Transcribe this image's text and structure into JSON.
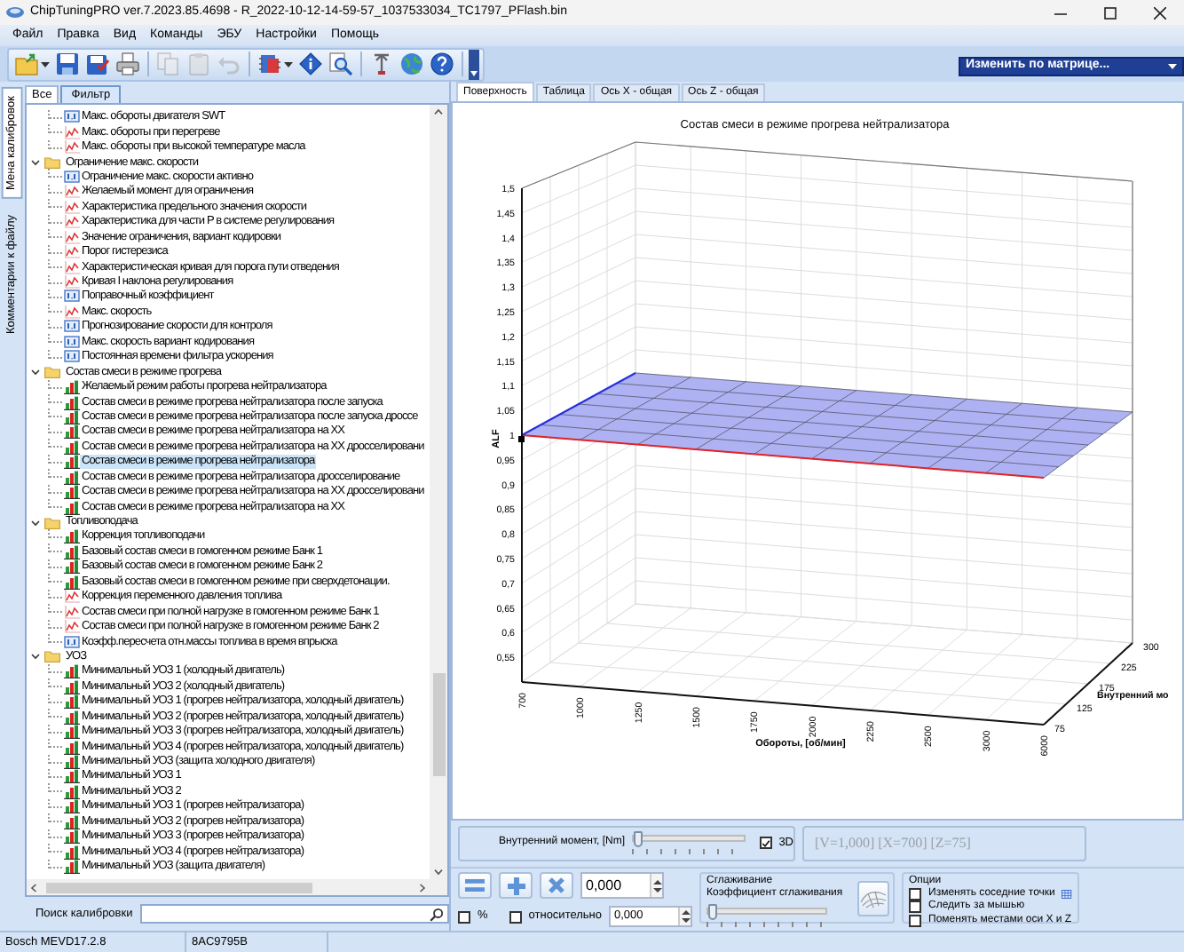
{
  "window": {
    "title": "ChipTuningPRO ver.7.2023.85.4698 - R_2022-10-12-14-59-57_1037533034_TC1797_PFlash.bin"
  },
  "menu": [
    "Файл",
    "Правка",
    "Вид",
    "Команды",
    "ЭБУ",
    "Настройки",
    "Помощь"
  ],
  "toolbar": [
    {
      "kind": "open",
      "disabled": false,
      "caret": true
    },
    {
      "kind": "save",
      "disabled": false
    },
    {
      "kind": "saveas",
      "disabled": false
    },
    {
      "kind": "print",
      "disabled": false
    },
    {
      "kind": "separator"
    },
    {
      "kind": "copy",
      "disabled": true
    },
    {
      "kind": "paste",
      "disabled": true
    },
    {
      "kind": "undo",
      "disabled": true
    },
    {
      "kind": "separator"
    },
    {
      "kind": "ecu",
      "disabled": false,
      "caret": true
    },
    {
      "kind": "info",
      "disabled": false
    },
    {
      "kind": "find",
      "disabled": false
    },
    {
      "kind": "separator"
    },
    {
      "kind": "tools",
      "disabled": false
    },
    {
      "kind": "globe",
      "disabled": false
    },
    {
      "kind": "help",
      "disabled": false
    }
  ],
  "matrix_dropdown": "Изменить по матрице...",
  "side_tabs": [
    {
      "label": "Мена калибровок",
      "selected": true
    },
    {
      "label": "Комментарии к файлу",
      "selected": false
    }
  ],
  "filter_tabs": [
    {
      "label": "Все",
      "selected": false
    },
    {
      "label": "Фильтр",
      "selected": true
    }
  ],
  "tree": [
    {
      "kind": "scalar",
      "label": "Макс. обороты двигателя SWT",
      "selected": false
    },
    {
      "kind": "curve",
      "label": "Макс. обороты при перегреве",
      "selected": false
    },
    {
      "kind": "curve",
      "label": "Макс. обороты при высокой температуре масла",
      "selected": false
    },
    {
      "kind": "folder",
      "label": "Ограничение макс. скорости",
      "expanded": true,
      "children": [
        {
          "kind": "scalar",
          "label": "Ограничение макс. скорости активно",
          "selected": false
        },
        {
          "kind": "curve",
          "label": "Желаемый момент для ограничения",
          "selected": false
        },
        {
          "kind": "curve",
          "label": "Характеристика предельного значения скорости",
          "selected": false
        },
        {
          "kind": "curve",
          "label": "Характеристика для части P в системе регулирования",
          "selected": false
        },
        {
          "kind": "curve",
          "label": "Значение ограничения, вариант кодировки",
          "selected": false
        },
        {
          "kind": "curve",
          "label": "Порог гистерезиса",
          "selected": false
        },
        {
          "kind": "curve",
          "label": "Характеристическая кривая для порога пути отведения",
          "selected": false
        },
        {
          "kind": "curve",
          "label": "Кривая I наклона регулирования",
          "selected": false
        },
        {
          "kind": "scalar",
          "label": "Поправочный коэффициент",
          "selected": false
        },
        {
          "kind": "curve",
          "label": "Макс. скорость",
          "selected": false
        },
        {
          "kind": "scalar",
          "label": "Прогнозирование скорости для контроля",
          "selected": false
        },
        {
          "kind": "scalar",
          "label": "Макс. скорость вариант кодирования",
          "selected": false
        },
        {
          "kind": "scalar",
          "label": "Постоянная времени фильтра ускорения",
          "selected": false
        }
      ]
    },
    {
      "kind": "folder",
      "label": "Состав смеси в режиме прогрева",
      "expanded": true,
      "children": [
        {
          "kind": "map",
          "label": "Желаемый режим работы прогрева нейтрализатора",
          "selected": false
        },
        {
          "kind": "map",
          "label": "Состав смеси в режиме прогрева нейтрализатора после запуска",
          "selected": false
        },
        {
          "kind": "map",
          "label": "Состав смеси в режиме прогрева нейтрализатора после запуска дроссе",
          "selected": false
        },
        {
          "kind": "map",
          "label": "Состав смеси в режиме прогрева нейтрализатора на ХХ",
          "selected": false
        },
        {
          "kind": "map",
          "label": "Состав смеси в режиме прогрева нейтрализатора на ХХ дросселировани",
          "selected": false
        },
        {
          "kind": "map",
          "label": "Состав смеси в режиме прогрева нейтрализатора",
          "selected": true
        },
        {
          "kind": "map",
          "label": "Состав смеси в режиме прогрева нейтрализатора дросселирование",
          "selected": false
        },
        {
          "kind": "map",
          "label": "Состав смеси в режиме прогрева нейтрализатора на ХХ дросселировани",
          "selected": false
        },
        {
          "kind": "map",
          "label": "Состав смеси в режиме прогрева нейтрализатора на ХХ",
          "selected": false
        }
      ]
    },
    {
      "kind": "folder",
      "label": "Топливоподача",
      "expanded": true,
      "children": [
        {
          "kind": "map",
          "label": "Коррекция топливоподачи",
          "selected": false
        },
        {
          "kind": "map",
          "label": "Базовый состав смеси в гомогенном режиме Банк 1",
          "selected": false
        },
        {
          "kind": "map",
          "label": "Базовый состав смеси в гомогенном режиме Банк 2",
          "selected": false
        },
        {
          "kind": "map",
          "label": "Базовый состав смеси в гомогенном режиме при сверхдетонации.",
          "selected": false
        },
        {
          "kind": "curve",
          "label": "Коррекция переменного давления топлива",
          "selected": false
        },
        {
          "kind": "curve",
          "label": "Состав смеси при полной нагрузке в гомогенном режиме Банк 1",
          "selected": false
        },
        {
          "kind": "curve",
          "label": "Состав смеси при полной нагрузке в гомогенном режиме Банк 2",
          "selected": false
        },
        {
          "kind": "scalar",
          "label": "Коэфф.пересчета отн.массы топлива в время впрыска",
          "selected": false
        }
      ]
    },
    {
      "kind": "folder",
      "label": "УОЗ",
      "expanded": true,
      "children": [
        {
          "kind": "map",
          "label": "Минимальный УОЗ 1 (холодный двигатель)",
          "selected": false
        },
        {
          "kind": "map",
          "label": "Минимальный УОЗ 2 (холодный двигатель)",
          "selected": false
        },
        {
          "kind": "map",
          "label": "Минимальный УОЗ 1 (прогрев нейтрализатора, холодный двигатель)",
          "selected": false
        },
        {
          "kind": "map",
          "label": "Минимальный УОЗ 2 (прогрев нейтрализатора, холодный двигатель)",
          "selected": false
        },
        {
          "kind": "map",
          "label": "Минимальный УОЗ 3 (прогрев нейтрализатора, холодный двигатель)",
          "selected": false
        },
        {
          "kind": "map",
          "label": "Минимальный УОЗ 4 (прогрев нейтрализатора, холодный двигатель)",
          "selected": false
        },
        {
          "kind": "map",
          "label": "Минимальный УОЗ (защита холодного двигателя)",
          "selected": false
        },
        {
          "kind": "map",
          "label": "Минимальный УОЗ 1",
          "selected": false
        },
        {
          "kind": "map",
          "label": "Минимальный УОЗ 2",
          "selected": false
        },
        {
          "kind": "map",
          "label": "Минимальный УОЗ 1 (прогрев нейтрализатора)",
          "selected": false
        },
        {
          "kind": "map",
          "label": "Минимальный УОЗ 2 (прогрев нейтрализатора)",
          "selected": false
        },
        {
          "kind": "map",
          "label": "Минимальный УОЗ 3 (прогрев нейтрализатора)",
          "selected": false
        },
        {
          "kind": "map",
          "label": "Минимальный УОЗ 4 (прогрев нейтрализатора)",
          "selected": false
        },
        {
          "kind": "map",
          "label": "Минимальный УОЗ (защита двигателя)",
          "selected": false
        }
      ]
    }
  ],
  "search": {
    "label": "Поиск калибровки"
  },
  "view_tabs": [
    {
      "label": "Поверхность",
      "selected": true
    },
    {
      "label": "Таблица",
      "selected": false
    },
    {
      "label": "Ось X - общая",
      "selected": false
    },
    {
      "label": "Ось Z - общая",
      "selected": false
    }
  ],
  "chart": {
    "title": "Состав смеси в режиме прогрева нейтрализатора",
    "zlabel": "ALF",
    "zticks": [
      "1,5",
      "1,45",
      "1,4",
      "1,35",
      "1,3",
      "1,25",
      "1,2",
      "1,15",
      "1,1",
      "1,05",
      "1",
      "0,95",
      "0,9",
      "0,85",
      "0,8",
      "0,75",
      "0,7",
      "0,65",
      "0,6",
      "0,55"
    ],
    "xlabel": "Обороты, [об/мин]",
    "xticks": [
      "700",
      "1000",
      "1250",
      "1500",
      "1750",
      "2000",
      "2250",
      "2500",
      "3000",
      "6000"
    ],
    "ylabel": "Внутренний мо",
    "yticks": [
      "75",
      "125",
      "175",
      "225",
      "300"
    ]
  },
  "axis_slider": {
    "label": "Внутренний момент, [Nm]",
    "level": 0
  },
  "view_3d": {
    "label": "3D",
    "checked": true
  },
  "readout": "[V=1,000] [X=700] [Z=75]",
  "edit": {
    "value": "0,000",
    "percent": {
      "label": "%",
      "checked": false
    },
    "relative": {
      "label": "относительно",
      "checked": false
    },
    "relative_value": "0,000"
  },
  "smoothing": {
    "title": "Сглаживание",
    "label": "Коэффициент сглаживания",
    "level": 0
  },
  "options": {
    "title": "Опции",
    "items": [
      {
        "label": "Изменять соседние точки",
        "checked": false
      },
      {
        "label": "Следить за мышью",
        "checked": false
      },
      {
        "label": "Поменять местами оси X и Z",
        "checked": false
      }
    ]
  },
  "status_bar": [
    "Bosch MEVD17.2.8",
    "8AC9795B"
  ]
}
